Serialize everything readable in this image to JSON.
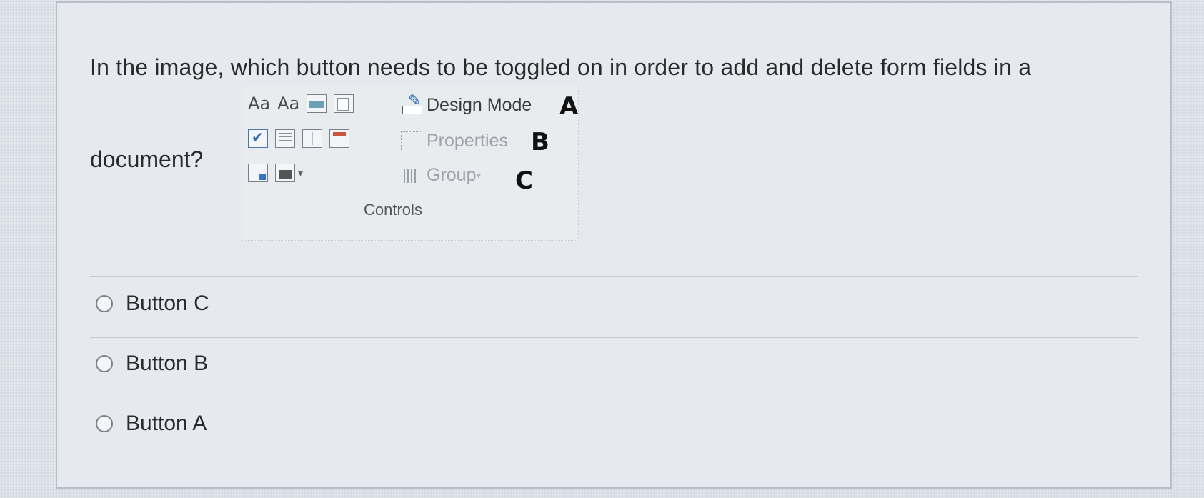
{
  "question": {
    "line1": "In the image, which button needs to be toggled on in order to add and delete form fields in a",
    "line2": "document?"
  },
  "ribbon": {
    "aa_1": "Aa",
    "aa_2": "Aa",
    "design_mode_label": "Design Mode",
    "properties_label": "Properties",
    "group_label": "Group",
    "group_caption": "Controls",
    "marker_a": "A",
    "marker_b": "B",
    "marker_c": "C",
    "icons": [
      "rich-text-content-control-icon",
      "plain-text-content-control-icon",
      "picture-content-control-icon",
      "building-block-gallery-icon",
      "checkbox-content-control-icon",
      "combo-box-icon",
      "dropdown-list-icon",
      "date-picker-icon",
      "legacy-tools-icon",
      "toolbox-icon",
      "design-mode-icon",
      "properties-icon",
      "group-icon"
    ]
  },
  "options": [
    {
      "label": "Button C"
    },
    {
      "label": "Button B"
    },
    {
      "label": "Button A"
    }
  ],
  "colors": {
    "background": "#dfe3ea",
    "card_border": "#b9bec6",
    "text": "#2a2a2a",
    "disabled_text": "#9da2a9",
    "accent_blue": "#2f6db5"
  }
}
